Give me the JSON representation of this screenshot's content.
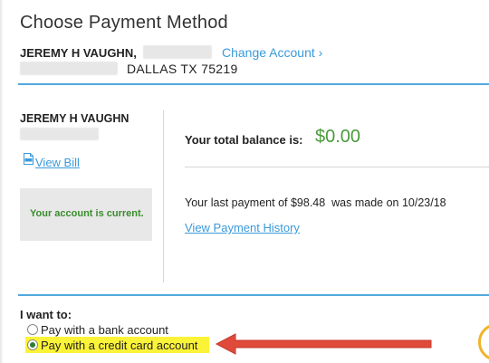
{
  "header": {
    "title": "Choose Payment Method",
    "account_name": "JEREMY H VAUGHN,",
    "change_account_label": "Change Account ›",
    "address_city_state_zip": "DALLAS  TX  75219"
  },
  "account_card": {
    "name": "JEREMY H VAUGHN",
    "view_bill_label": "View Bill",
    "status": "Your account is current."
  },
  "balance": {
    "label": "Your total balance is:",
    "value": "$0.00",
    "value_color": "#4a9a3c"
  },
  "last_payment": {
    "text": "Your last payment of $98.48  was made on 10/23/18",
    "history_link": "View Payment History"
  },
  "payment_options": {
    "heading": "I want to:",
    "options": [
      {
        "label": "Pay with a bank account",
        "selected": false
      },
      {
        "label": "Pay with a credit card account",
        "selected": true
      }
    ]
  },
  "colors": {
    "link": "#3b9ad9",
    "divider": "#52a9de",
    "status_text": "#3a8c2e",
    "highlight": "#fbf338",
    "annotation_arrow": "#e04a3a"
  },
  "icons": [
    "pdf-icon",
    "annotation-arrow-icon",
    "help-icon"
  ]
}
